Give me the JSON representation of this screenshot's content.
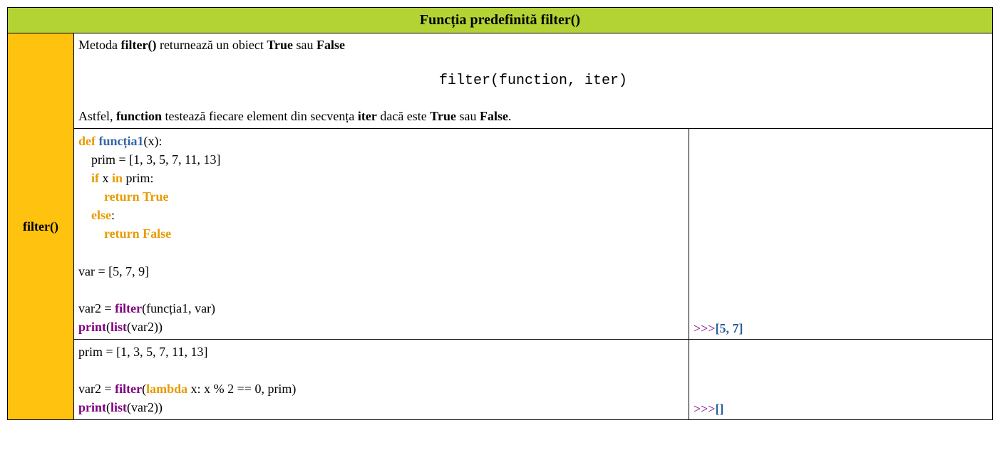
{
  "header": {
    "title": "Funcția predefinită filter()"
  },
  "side": {
    "label": "filter()"
  },
  "description": {
    "intro_1": "Metoda ",
    "intro_b1": "filter()",
    "intro_2": " returnează un obiect ",
    "intro_b2": "True",
    "intro_3": " sau ",
    "intro_b3": "False",
    "syntax": "filter(function, iter)",
    "tail_1": "Astfel, ",
    "tail_b1": "function",
    "tail_2": " testează fiecare element din secvența ",
    "tail_b2": "iter",
    "tail_3": " dacă este ",
    "tail_b3": "True",
    "tail_4": " sau ",
    "tail_b4": "False",
    "tail_5": "."
  },
  "code1": {
    "def_kw": "def",
    "fn_name": "funcția1",
    "def_rest": "(x):",
    "l2": "    prim = [1, 3, 5, 7, 11, 13]",
    "if_kw": "if",
    "if_mid": " x ",
    "in_kw": "in",
    "if_tail": " prim:",
    "ret_true_indent": "        ",
    "ret_true": "return True",
    "else_indent": "    ",
    "else_kw": "else",
    "else_colon": ":",
    "ret_false_indent": "        ",
    "ret_false": "return False",
    "var_line": "var = [5, 7, 9]",
    "var2_pre": "var2 = ",
    "filter_kw": "filter",
    "var2_post": "(funcția1, var)",
    "print_kw": "print",
    "print_open": "(",
    "list_kw": "list",
    "print_rest": "(var2))"
  },
  "out1": {
    "prompt": ">>>",
    "value": "[5, 7]"
  },
  "code2": {
    "l1": "prim = [1, 3, 5, 7, 11, 13]",
    "var2_pre": "var2 = ",
    "filter_kw": "filter",
    "open": "(",
    "lambda_kw": "lambda",
    "lambda_rest": " x: x % 2 == 0, prim)",
    "print_kw": "print",
    "print_open": "(",
    "list_kw": "list",
    "print_rest": "(var2))"
  },
  "out2": {
    "prompt": ">>>",
    "value": "[]"
  }
}
